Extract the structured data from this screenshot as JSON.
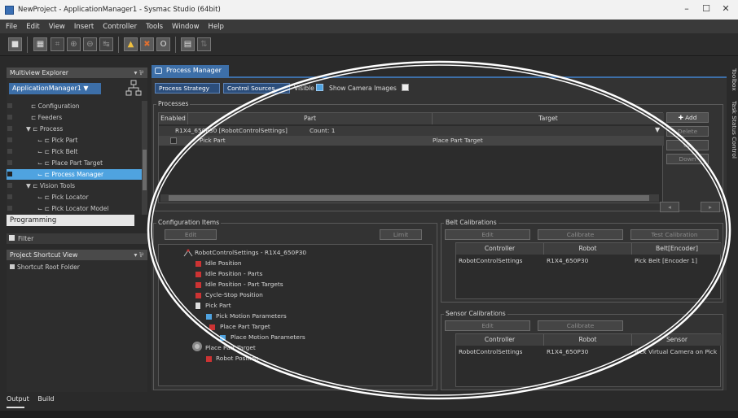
{
  "window": {
    "title": "NewProject - ApplicationManager1 - Sysmac Studio (64bit)",
    "minimize": "–",
    "maximize": "☐",
    "close": "✕"
  },
  "menu": [
    "File",
    "Edit",
    "View",
    "Insert",
    "Controller",
    "Tools",
    "Window",
    "Help"
  ],
  "multiview": {
    "title": "Multiview Explorer",
    "pin": "▾ ⅌",
    "selector": "ApplicationManager1 ▼",
    "tree": [
      {
        "label": "⊏ Configuration",
        "indent": 30
      },
      {
        "label": "⊏ Feeders",
        "indent": 30
      },
      {
        "label": "▼ ⊏ Process",
        "indent": 24
      },
      {
        "label": "⌙ ⊏ Pick Part",
        "indent": 38
      },
      {
        "label": "⌙ ⊏ Pick Belt",
        "indent": 38
      },
      {
        "label": "⌙ ⊏ Place Part Target",
        "indent": 38
      },
      {
        "label": "⌙ ⊏ Process Manager",
        "indent": 38,
        "selected": true
      },
      {
        "label": "▼ ⊏ Vision Tools",
        "indent": 24
      },
      {
        "label": "⌙ ⊏ Pick Locator",
        "indent": 38
      },
      {
        "label": "⌙ ⊏ Pick Locator Model",
        "indent": 38
      }
    ],
    "programming": "Programming",
    "filter": "Filter"
  },
  "shortcut": {
    "title": "Project Shortcut View",
    "pin": "▾ ⅌",
    "root": "Shortcut Root Folder"
  },
  "bottom_tabs": [
    "Output",
    "Build"
  ],
  "doc_tab": {
    "label": "Process Manager",
    "close": "✕"
  },
  "toolbar_main": {
    "process_strategy": "Process Strategy",
    "control_sources": "Control Sources",
    "visible_label": "Visible",
    "show_camera_label": "Show Camera Images"
  },
  "processes": {
    "label": "Processes",
    "headers": [
      "Enabled",
      "Part",
      "Target"
    ],
    "group_row": {
      "name": "R1X4_650P30 [RobotControlSettings]",
      "count": "Count: 1"
    },
    "rows": [
      {
        "part": "Pick Part",
        "target": "Place Part Target"
      }
    ],
    "buttons": {
      "add": "Add",
      "delete": "Delete",
      "up": "Up",
      "down": "Down"
    }
  },
  "config_items": {
    "label": "Configuration Items",
    "edit": "Edit",
    "limit": "Limit",
    "items": [
      {
        "label": "RobotControlSettings - R1X4_650P30",
        "indent": 44
      },
      {
        "label": "Idle Position",
        "indent": 57
      },
      {
        "label": "Idle Position - Parts",
        "indent": 57
      },
      {
        "label": "Idle Position - Part Targets",
        "indent": 57
      },
      {
        "label": "Cycle-Stop Position",
        "indent": 57
      },
      {
        "label": "Pick Part",
        "indent": 57
      },
      {
        "label": "Pick Motion Parameters",
        "indent": 70
      },
      {
        "label": "Place Part Target",
        "indent": 75
      },
      {
        "label": "Place Motion Parameters",
        "indent": 88
      },
      {
        "label": "Place Part Target",
        "indent": 57
      },
      {
        "label": "Robot Position",
        "indent": 70
      }
    ]
  },
  "belt_cal": {
    "label": "Belt Calibrations",
    "buttons": [
      "Edit",
      "Calibrate",
      "Test Calibration"
    ],
    "headers": [
      "Controller",
      "Robot",
      "Belt[Encoder]"
    ],
    "rows": [
      {
        "controller": "RobotControlSettings",
        "robot": "R1X4_650P30",
        "belt": "Pick Belt [Encoder 1]"
      }
    ]
  },
  "sensor_cal": {
    "label": "Sensor Calibrations",
    "buttons": [
      "Edit",
      "Calibrate"
    ],
    "headers": [
      "Controller",
      "Robot",
      "Sensor"
    ],
    "rows": [
      {
        "controller": "RobotControlSettings",
        "robot": "R1X4_650P30",
        "sensor": "Pick Virtual Camera on Pick"
      }
    ]
  },
  "right_strip": [
    "Toolbox",
    "Task Status Control"
  ],
  "colors": {
    "accent": "#3d6fa8",
    "selection": "#4fa3e0",
    "ellipse": "#ffffff"
  }
}
